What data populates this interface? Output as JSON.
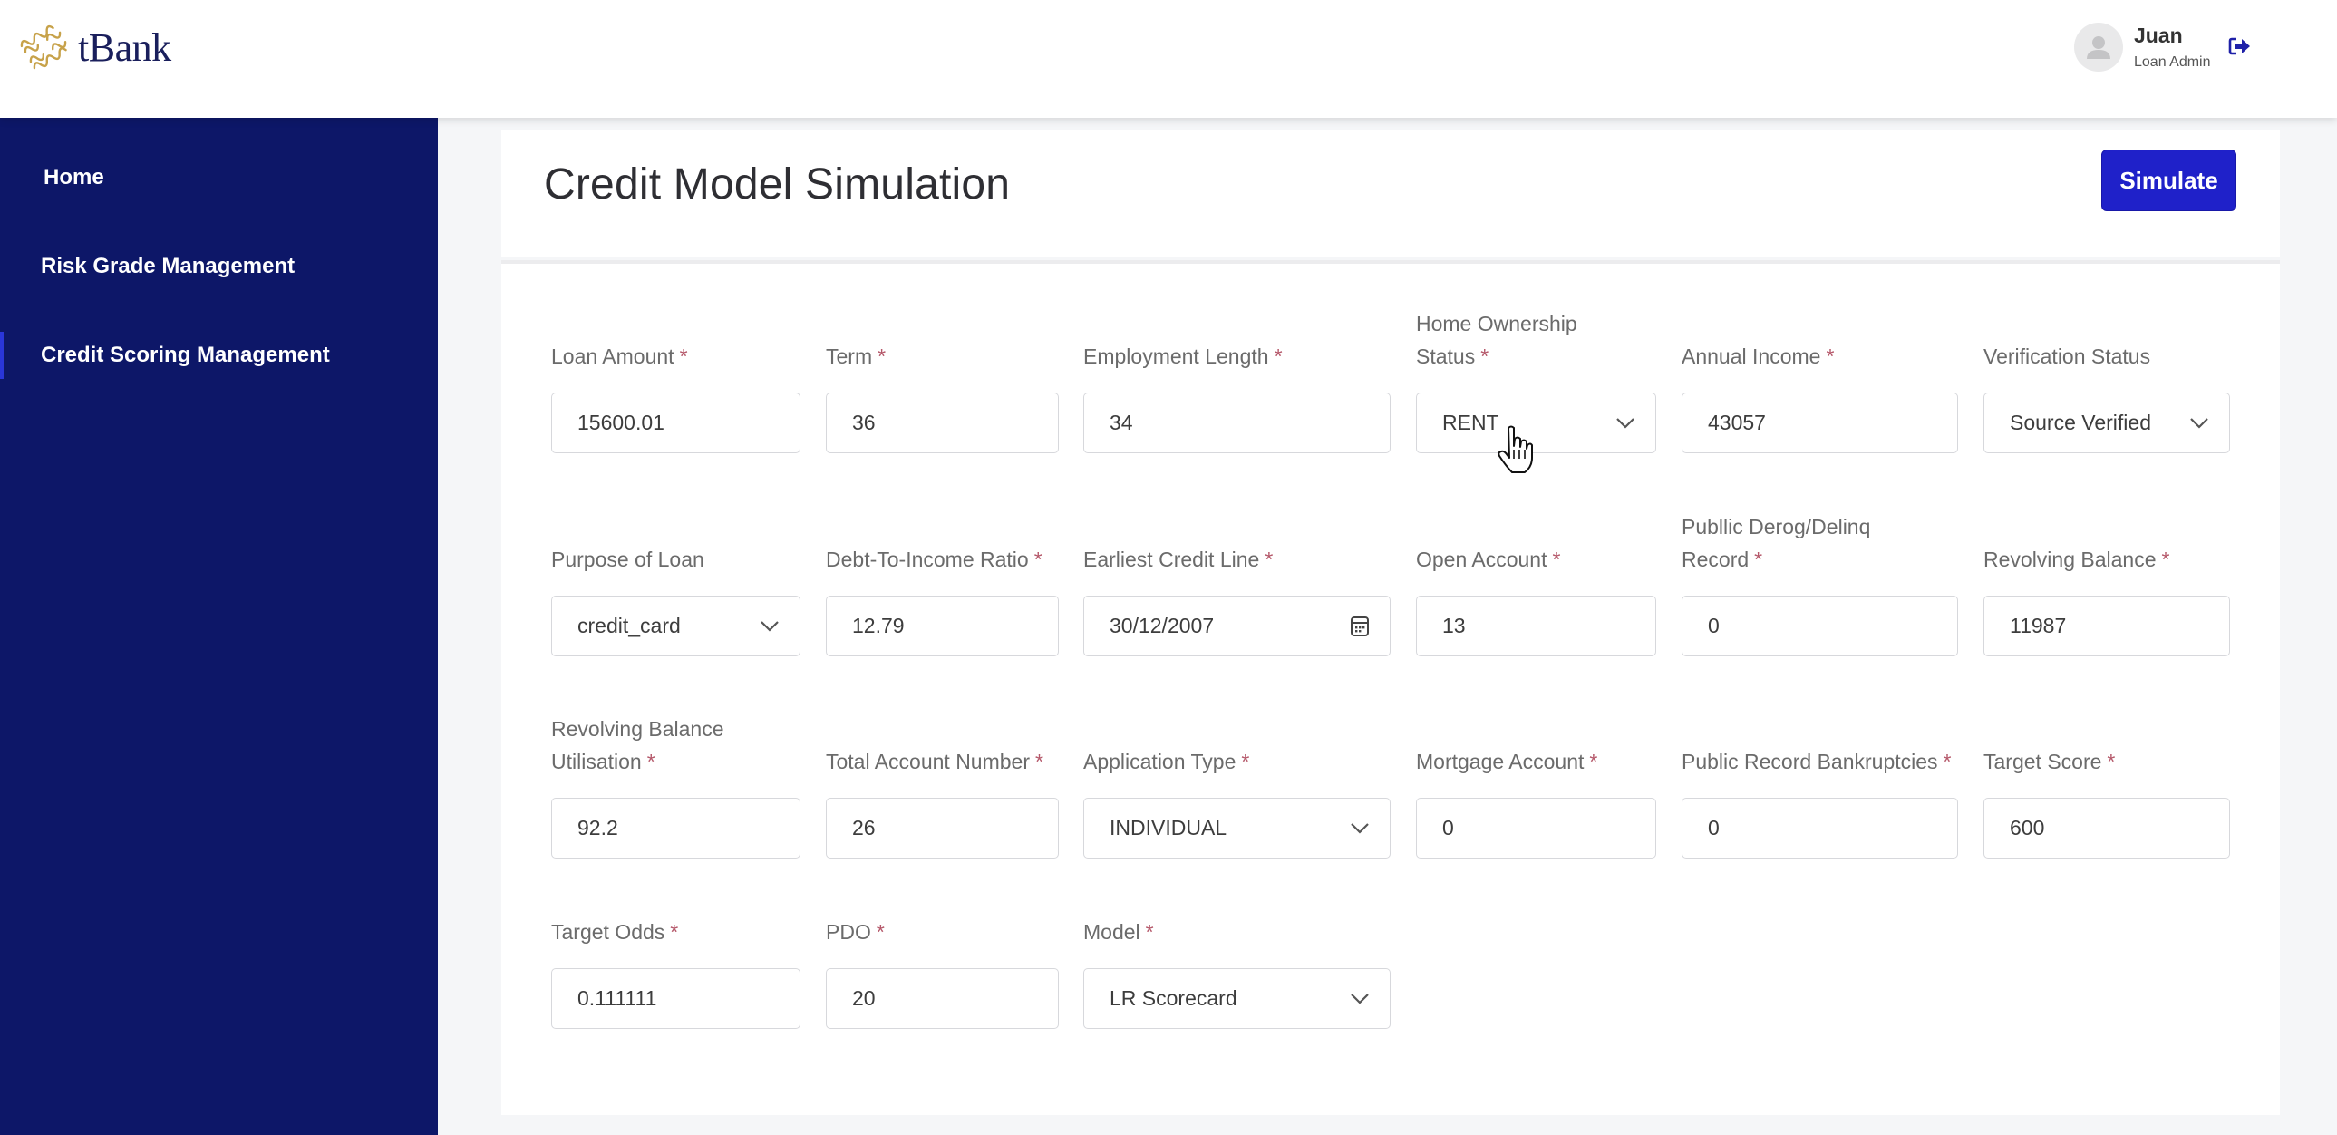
{
  "header": {
    "logo_text": "tBank",
    "user": {
      "name": "Juan",
      "role": "Loan Admin"
    },
    "icons": {
      "avatar": "user-avatar-icon",
      "logout": "logout-icon"
    }
  },
  "sidebar": {
    "items": [
      {
        "label": "Home",
        "active": false
      },
      {
        "label": "Risk Grade Management",
        "active": false
      },
      {
        "label": "Credit Scoring Management",
        "active": true
      }
    ]
  },
  "page": {
    "title": "Credit Model Simulation",
    "simulate_label": "Simulate"
  },
  "colors": {
    "sidebar_bg": "#0d1768",
    "primary_button": "#1f21c9",
    "required_asterisk": "#b5586a"
  },
  "form": {
    "required_mark": "*",
    "fields": [
      {
        "label": "Loan Amount",
        "required": true,
        "type": "input",
        "value": "15600.01"
      },
      {
        "label": "Term",
        "required": true,
        "type": "input",
        "value": "36"
      },
      {
        "label": "Employment Length",
        "required": true,
        "type": "input",
        "value": "34"
      },
      {
        "label_line1": "Home Ownership",
        "label": "Status",
        "required": true,
        "type": "select",
        "value": "RENT"
      },
      {
        "label": "Annual Income",
        "required": true,
        "type": "input",
        "value": "43057"
      },
      {
        "label": "Verification Status",
        "required": false,
        "type": "select",
        "value": "Source Verified"
      },
      {
        "label": "Purpose of Loan",
        "required": false,
        "type": "select",
        "value": "credit_card"
      },
      {
        "label": "Debt-To-Income Ratio",
        "required": true,
        "type": "input",
        "value": "12.79"
      },
      {
        "label": "Earliest Credit Line",
        "required": true,
        "type": "date",
        "value": "30/12/2007"
      },
      {
        "label": "Open Account",
        "required": true,
        "type": "input",
        "value": "13"
      },
      {
        "label_line1": "Publlic Derog/Delinq",
        "label": "Record",
        "required": true,
        "type": "input",
        "value": "0"
      },
      {
        "label": "Revolving Balance",
        "required": true,
        "type": "input",
        "value": "11987"
      },
      {
        "label_line1": "Revolving Balance",
        "label": "Utilisation",
        "required": true,
        "type": "input",
        "value": "92.2"
      },
      {
        "label": "Total Account Number",
        "required": true,
        "type": "input",
        "value": "26"
      },
      {
        "label": "Application Type",
        "required": true,
        "type": "select",
        "value": "INDIVIDUAL"
      },
      {
        "label": "Mortgage Account",
        "required": true,
        "type": "input",
        "value": "0"
      },
      {
        "label": "Public Record Bankruptcies",
        "required": true,
        "type": "input",
        "value": "0"
      },
      {
        "label": "Target Score",
        "required": true,
        "type": "input",
        "value": "600"
      },
      {
        "label": "Target Odds",
        "required": true,
        "type": "input",
        "value": "0.111111"
      },
      {
        "label": "PDO",
        "required": true,
        "type": "input",
        "value": "20"
      },
      {
        "label": "Model",
        "required": true,
        "type": "select",
        "value": "LR Scorecard"
      }
    ]
  }
}
